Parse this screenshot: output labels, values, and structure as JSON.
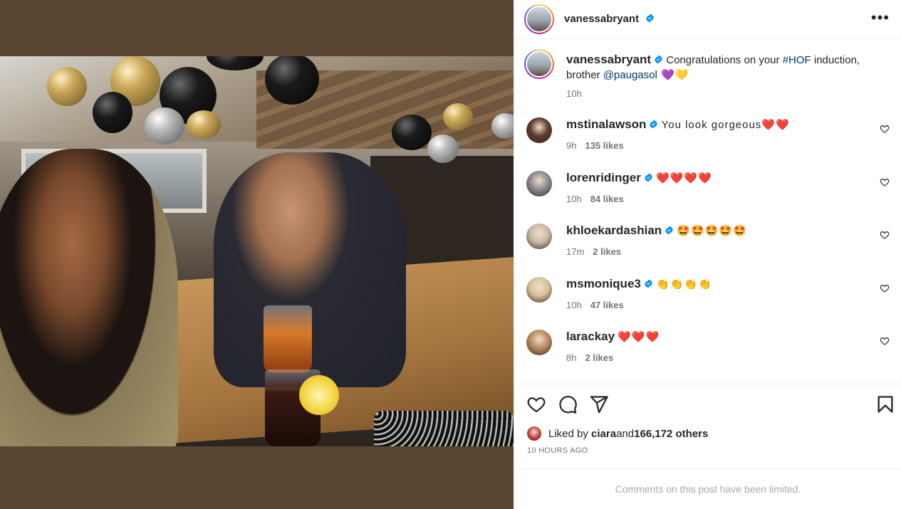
{
  "post": {
    "author": "vanessabryant",
    "verified": true
  },
  "caption": {
    "username": "vanessabryant",
    "text_before": " Congratulations on your ",
    "hashtag": "#HOF",
    "text_middle": " induction, brother ",
    "mention": "@paugasol",
    "text_after": " 💜💛",
    "time": "10h"
  },
  "comments": [
    {
      "username": "mstinalawson",
      "verified": true,
      "text": "You look gorgeous❤️❤️",
      "time": "9h",
      "likes": "135 likes",
      "avatar_color": "#5b3a2a"
    },
    {
      "username": "lorenridinger",
      "verified": true,
      "text": "❤️❤️❤️❤️",
      "time": "10h",
      "likes": "84 likes",
      "avatar_color": "#8a8a8a"
    },
    {
      "username": "khloekardashian",
      "verified": true,
      "text": "🤩🤩🤩🤩🤩",
      "time": "17m",
      "likes": "2 likes",
      "avatar_color": "#c9b9a6"
    },
    {
      "username": "msmonique3",
      "verified": true,
      "text": "👏👏👏👏",
      "time": "10h",
      "likes": "47 likes",
      "avatar_color": "#d7c29a"
    },
    {
      "username": "larackay",
      "verified": false,
      "text": "❤️❤️❤️",
      "time": "8h",
      "likes": "2 likes",
      "avatar_color": "#b88a5e"
    }
  ],
  "liked_by": {
    "prefix": "Liked by ",
    "user": "ciara",
    "middle": " and ",
    "others": "166,172 others"
  },
  "timestamp": "10 HOURS AGO",
  "limited_notice": "Comments on this post have been limited.",
  "icons": {
    "more": "more-options-icon",
    "like": "heart-icon",
    "comment": "comment-icon",
    "share": "share-icon",
    "save": "bookmark-icon"
  },
  "colors": {
    "link": "#00376b",
    "verified": "#0095f6",
    "muted": "#737373"
  }
}
